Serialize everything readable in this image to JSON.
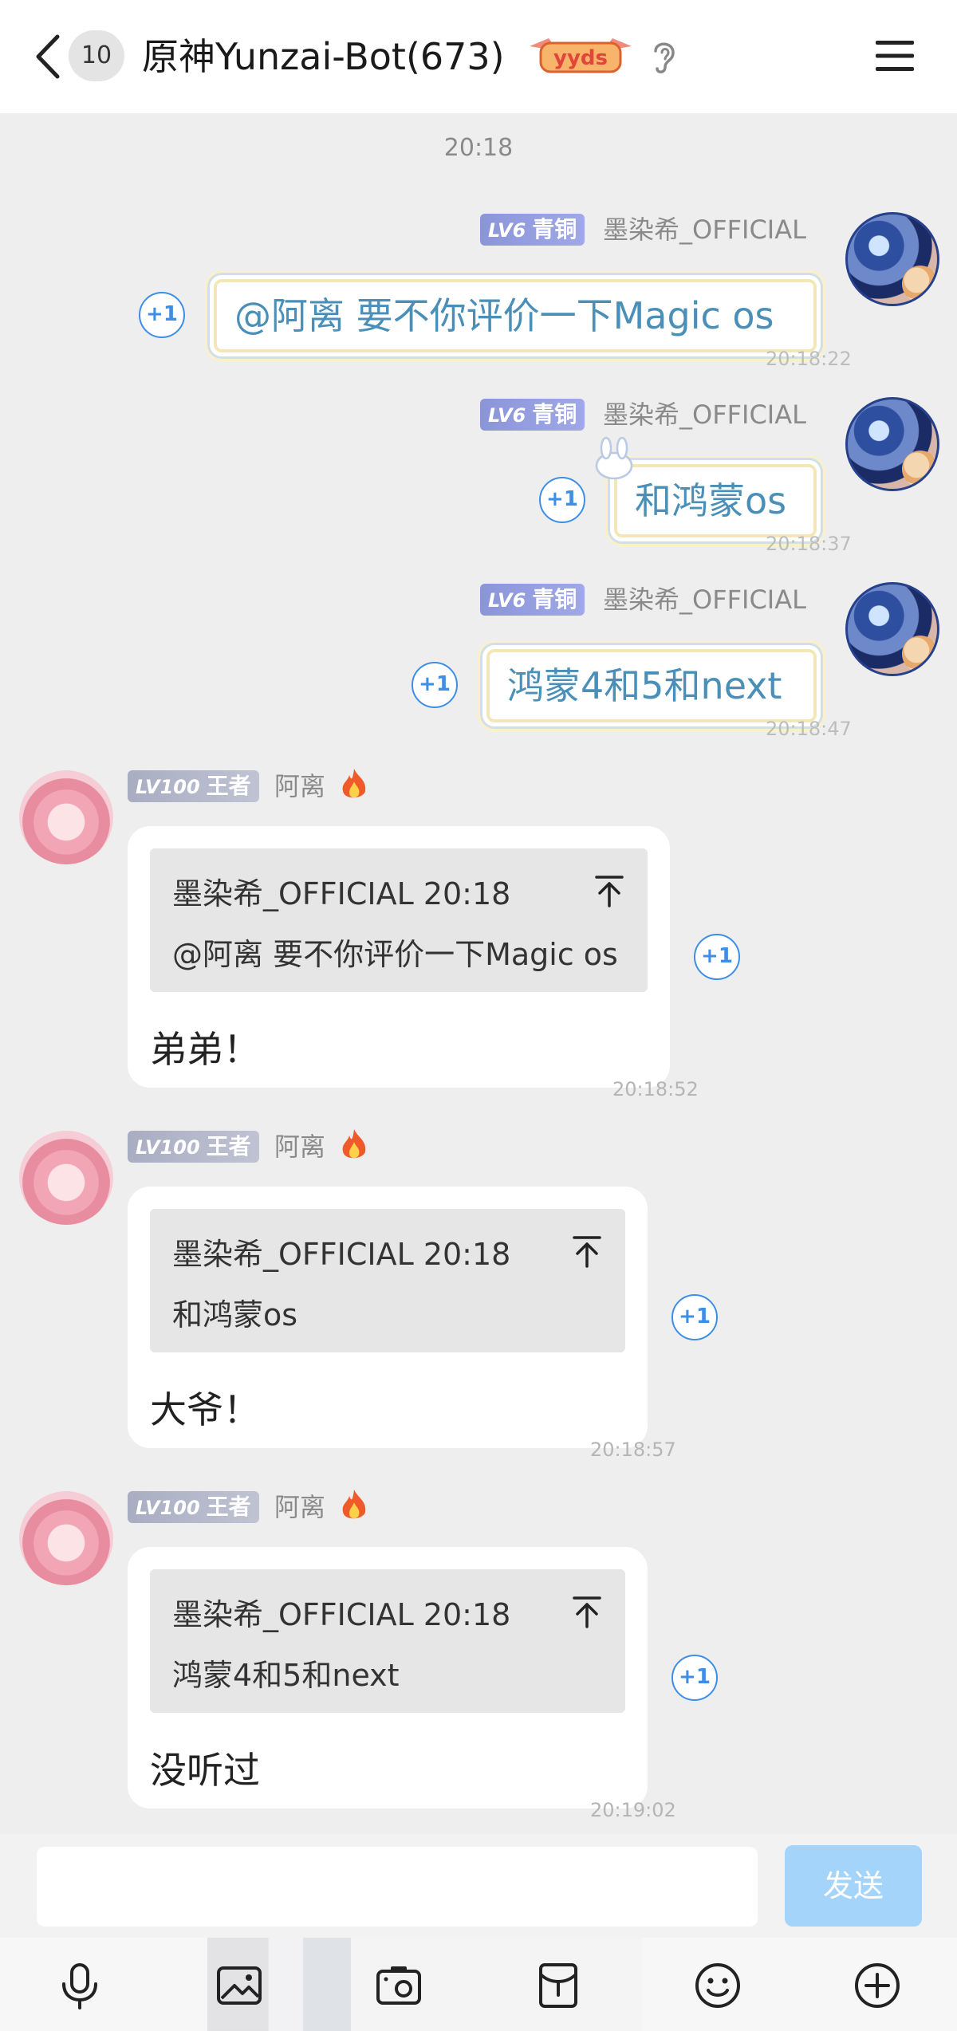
{
  "header": {
    "unread_count": "10",
    "title": "原神Yunzai-Bot(673)",
    "badge_text": "yyds",
    "icons": {
      "back": "chevron-left-icon",
      "ear": "ear-icon",
      "menu": "hamburger-menu-icon"
    }
  },
  "time_separator": "20:18",
  "messages_right": [
    {
      "level": "LV6",
      "title": "青铜",
      "sender": "墨染希_OFFICIAL",
      "text": "@阿离 要不你评价一下Magic os",
      "time": "20:18:22",
      "plus_one": "+1"
    },
    {
      "level": "LV6",
      "title": "青铜",
      "sender": "墨染希_OFFICIAL",
      "text": "和鸿蒙os",
      "time": "20:18:37",
      "plus_one": "+1"
    },
    {
      "level": "LV6",
      "title": "青铜",
      "sender": "墨染希_OFFICIAL",
      "text": "鸿蒙4和5和next",
      "time": "20:18:47",
      "plus_one": "+1"
    }
  ],
  "messages_left": [
    {
      "level": "LV100",
      "title": "王者",
      "sender": "阿离",
      "quote_head": "墨染希_OFFICIAL 20:18",
      "quote_body": "@阿离 要不你评价一下Magic os",
      "text": "弟弟！",
      "time": "20:18:52",
      "plus_one": "+1"
    },
    {
      "level": "LV100",
      "title": "王者",
      "sender": "阿离",
      "quote_head": "墨染希_OFFICIAL 20:18",
      "quote_body": "和鸿蒙os",
      "text": "大爷！",
      "time": "20:18:57",
      "plus_one": "+1"
    },
    {
      "level": "LV100",
      "title": "王者",
      "sender": "阿离",
      "quote_head": "墨染希_OFFICIAL 20:18",
      "quote_body": "鸿蒙4和5和next",
      "text": "没听过",
      "time": "20:19:02",
      "plus_one": "+1"
    }
  ],
  "composer": {
    "input_value": "",
    "send_label": "发送"
  },
  "toolbar": {
    "icons": [
      "microphone-icon",
      "image-icon",
      "camera-icon",
      "red-packet-icon",
      "emoji-icon",
      "plus-circle-icon"
    ]
  },
  "colors": {
    "accent": "#3d8ee6",
    "send_disabled": "#a4d4fa",
    "bubble_text_right": "#4a8fb8",
    "background": "#eeeeee"
  }
}
